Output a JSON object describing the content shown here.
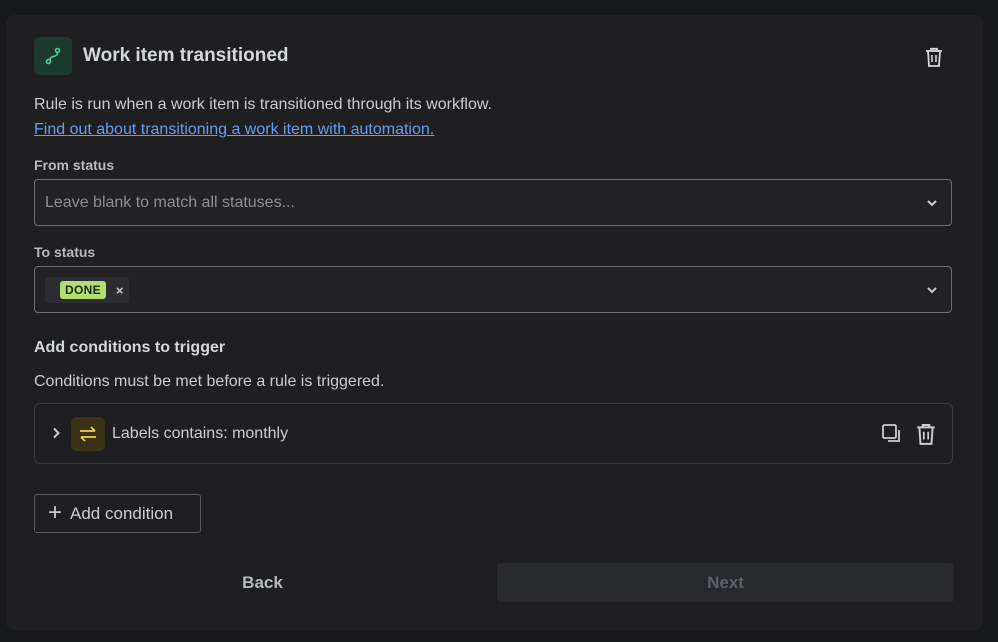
{
  "trigger": {
    "icon": "transition-icon",
    "title": "Work item transitioned",
    "delete_icon": "trash-icon",
    "description": "Rule is run when a work item is transitioned through its workflow.",
    "link_text": "Find out about transitioning a work item with automation."
  },
  "from_status": {
    "label": "From status",
    "placeholder": "Leave blank to match all statuses..."
  },
  "to_status": {
    "label": "To status",
    "selected": [
      "DONE"
    ],
    "remove_glyph": "×"
  },
  "conditions": {
    "title": "Add conditions to trigger",
    "description": "Conditions must be met before a rule is triggered.",
    "items": [
      {
        "icon": "swap-arrows-icon",
        "text": "Labels contains: monthly"
      }
    ],
    "add_label": "Add condition",
    "add_glyph": "+"
  },
  "footer": {
    "back_label": "Back",
    "next_label": "Next"
  },
  "colors": {
    "accent_link": "#669df1",
    "done_lozenge": "#b3df72",
    "trigger_icon_bg": "#1c3a2d",
    "condition_icon_bg": "#3a3216"
  }
}
